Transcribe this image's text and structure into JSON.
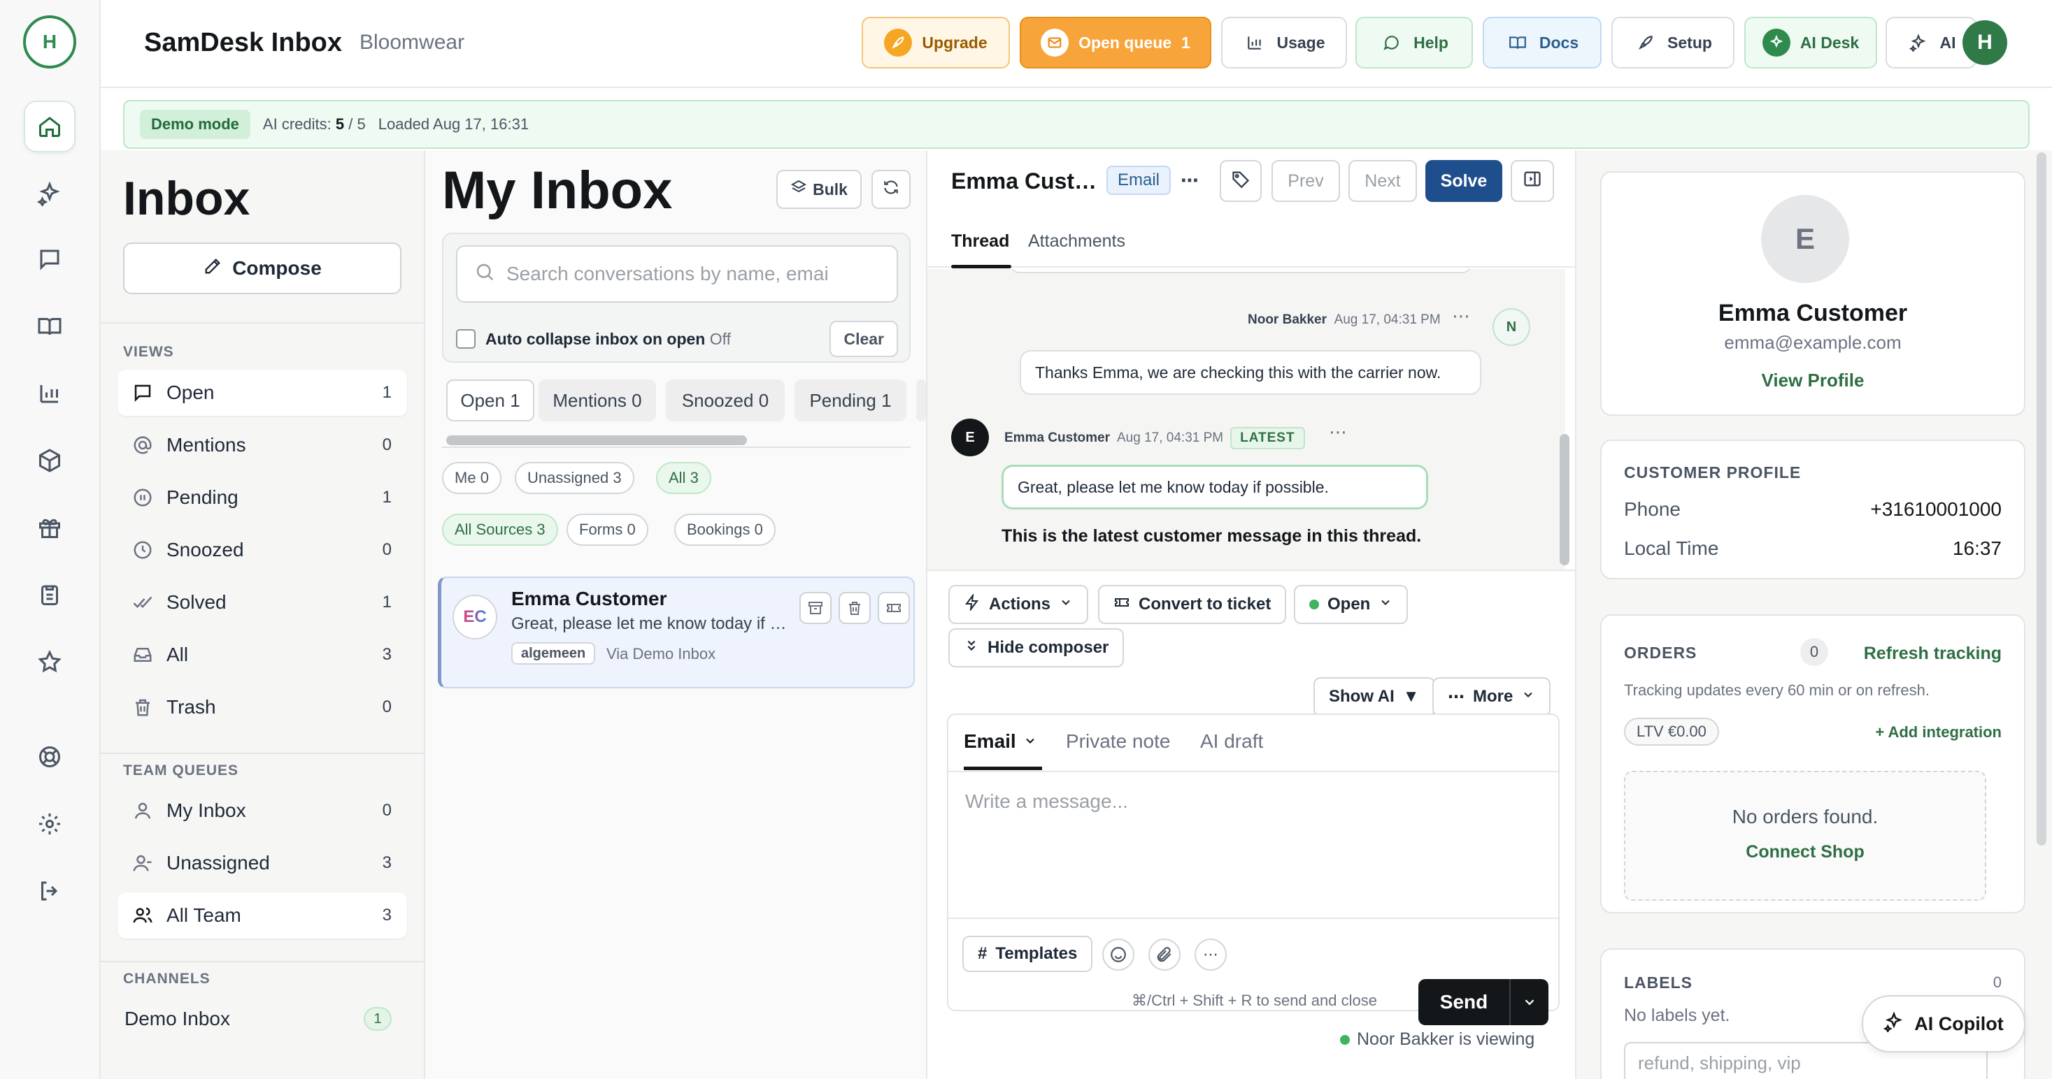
{
  "rail": {
    "avatar_letter": "H"
  },
  "header": {
    "title": "SamDesk Inbox",
    "subtitle": "Bloomwear",
    "buttons": {
      "upgrade": "Upgrade",
      "open_queue": "Open queue",
      "open_queue_count": "1",
      "usage": "Usage",
      "help": "Help",
      "docs": "Docs",
      "setup": "Setup",
      "ai_desk": "AI Desk",
      "ai": "AI"
    },
    "user_initial": "H"
  },
  "banner": {
    "tag": "Demo mode",
    "credits_label": "AI credits:",
    "credits_used": "5",
    "credits_sep": "/",
    "credits_total": "5",
    "loaded": "Loaded Aug 17, 16:31"
  },
  "nav": {
    "title": "Inbox",
    "compose": "Compose",
    "views_header": "VIEWS",
    "views": [
      {
        "label": "Open",
        "count": "1"
      },
      {
        "label": "Mentions",
        "count": "0"
      },
      {
        "label": "Pending",
        "count": "1"
      },
      {
        "label": "Snoozed",
        "count": "0"
      },
      {
        "label": "Solved",
        "count": "1"
      },
      {
        "label": "All",
        "count": "3"
      },
      {
        "label": "Trash",
        "count": "0"
      }
    ],
    "queues_header": "TEAM QUEUES",
    "queues": [
      {
        "label": "My Inbox",
        "count": "0"
      },
      {
        "label": "Unassigned",
        "count": "3"
      },
      {
        "label": "All Team",
        "count": "3"
      }
    ],
    "channels_header": "CHANNELS",
    "channels": [
      {
        "label": "Demo Inbox",
        "count": "1"
      }
    ]
  },
  "list": {
    "title": "My Inbox",
    "bulk": "Bulk",
    "search_placeholder": "Search conversations by name, emai",
    "auto_collapse_label": "Auto collapse inbox on open",
    "auto_collapse_state": "Off",
    "clear": "Clear",
    "tabs": [
      {
        "label": "Open",
        "count": "1"
      },
      {
        "label": "Mentions",
        "count": "0"
      },
      {
        "label": "Snoozed",
        "count": "0"
      },
      {
        "label": "Pending",
        "count": "1"
      }
    ],
    "assignee_pills": [
      {
        "label": "Me",
        "count": "0"
      },
      {
        "label": "Unassigned",
        "count": "3"
      },
      {
        "label": "All",
        "count": "3"
      }
    ],
    "source_pills": [
      {
        "label": "All Sources",
        "count": "3"
      },
      {
        "label": "Forms",
        "count": "0"
      },
      {
        "label": "Bookings",
        "count": "0"
      }
    ],
    "conversation": {
      "initials": "EC",
      "name": "Emma Customer",
      "snippet": "Great, please let me know today if possible.",
      "tag": "algemeen",
      "via": "Via Demo Inbox"
    }
  },
  "thread": {
    "name": "Emma Customer",
    "channel_badge": "Email",
    "prev": "Prev",
    "next": "Next",
    "solve": "Solve",
    "tabs": {
      "thread": "Thread",
      "attachments": "Attachments"
    },
    "messages": [
      {
        "author": "Noor Bakker",
        "time": "Aug 17, 04:31 PM",
        "initial": "N",
        "text": "Thanks Emma, we are checking this with the carrier now."
      },
      {
        "author": "Emma Customer",
        "time": "Aug 17, 04:31 PM",
        "initial": "E",
        "tag": "LATEST",
        "text": "Great, please let me know today if possible."
      }
    ],
    "latest_note": "This is the latest customer message in this thread.",
    "composer": {
      "actions": "Actions",
      "convert": "Convert to ticket",
      "status": "Open",
      "hide": "Hide composer",
      "show_ai": "Show AI",
      "more": "More",
      "tabs": {
        "email": "Email",
        "private": "Private note",
        "draft": "AI draft"
      },
      "placeholder": "Write a message...",
      "templates": "Templates",
      "shortcut": "⌘/Ctrl + Shift + R to send and close",
      "send": "Send",
      "viewing": "Noor Bakker is viewing"
    }
  },
  "customer": {
    "initial": "E",
    "name": "Emma Customer",
    "email": "emma@example.com",
    "view_profile": "View Profile",
    "profile_header": "CUSTOMER PROFILE",
    "phone_label": "Phone",
    "phone": "+31610001000",
    "local_time_label": "Local Time",
    "local_time": "16:37",
    "orders_header": "ORDERS",
    "orders_count": "0",
    "refresh": "Refresh tracking",
    "tracking_note": "Tracking updates every 60 min or on refresh.",
    "ltv": "LTV €0.00",
    "add_integration": "+ Add integration",
    "no_orders": "No orders found.",
    "connect_shop": "Connect Shop",
    "labels_header": "LABELS",
    "labels_count": "0",
    "no_labels": "No labels yet.",
    "labels_placeholder": "refund, shipping, vip"
  },
  "copilot": "AI Copilot",
  "colors": {
    "brand_green": "#2f8a4e",
    "solve_blue": "#1f4e8c",
    "queue_orange": "#f7a43a"
  }
}
